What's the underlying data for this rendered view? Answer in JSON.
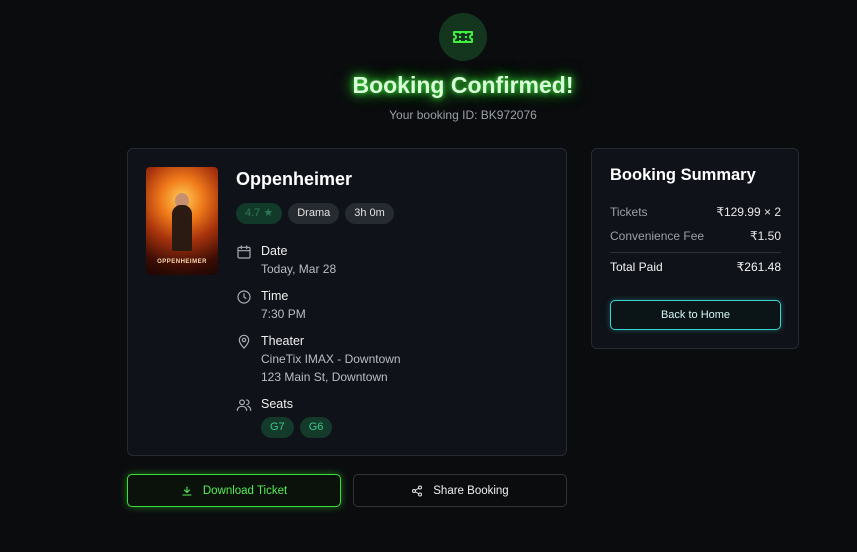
{
  "header": {
    "title": "Booking Confirmed!",
    "booking_id_text": "Your booking ID: BK972076",
    "icon": "ticket-icon"
  },
  "movie": {
    "title": "Oppenheimer",
    "poster_title": "OPPENHEIMER",
    "rating": "4.7 ★",
    "genre": "Drama",
    "duration": "3h 0m",
    "date": {
      "label": "Date",
      "value": "Today, Mar 28",
      "icon": "calendar-icon"
    },
    "time": {
      "label": "Time",
      "value": "7:30 PM",
      "icon": "clock-icon"
    },
    "theater": {
      "label": "Theater",
      "name": "CineTix IMAX - Downtown",
      "address": "123 Main St, Downtown",
      "icon": "map-pin-icon"
    },
    "seats": {
      "label": "Seats",
      "list": [
        "G7",
        "G6"
      ],
      "icon": "users-icon"
    }
  },
  "actions": {
    "download_label": "Download Ticket",
    "share_label": "Share Booking"
  },
  "summary": {
    "title": "Booking Summary",
    "tickets_label": "Tickets",
    "tickets_value": "₹129.99 × 2",
    "fee_label": "Convenience Fee",
    "fee_value": "₹1.50",
    "total_label": "Total Paid",
    "total_value": "₹261.48",
    "home_label": "Back to Home"
  },
  "colors": {
    "background": "#0b0c0e",
    "accent_green": "#39e039",
    "accent_cyan": "#3ad6d6",
    "card": "#0f1218"
  }
}
